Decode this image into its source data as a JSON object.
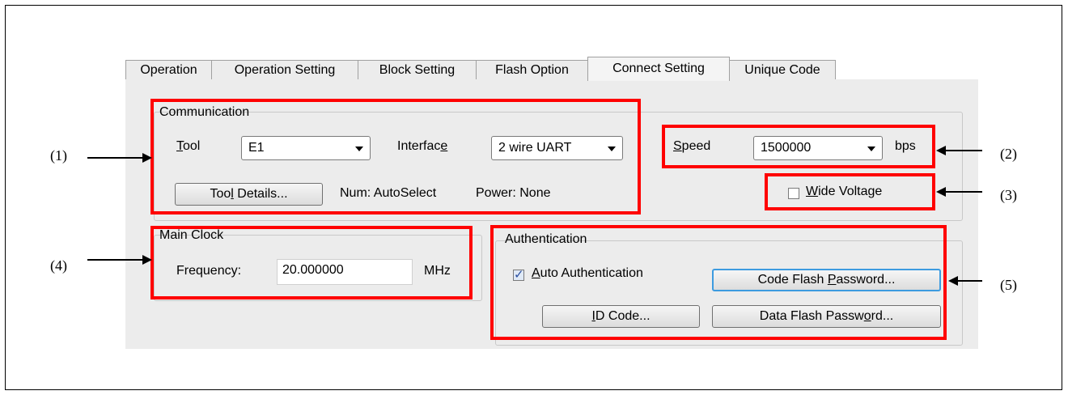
{
  "tabs": [
    {
      "label": "Operation"
    },
    {
      "label": "Operation Setting"
    },
    {
      "label": "Block Setting"
    },
    {
      "label": "Flash Option"
    },
    {
      "label": "Connect Setting"
    },
    {
      "label": "Unique Code"
    }
  ],
  "active_tab": "Connect Setting",
  "communication": {
    "title": "Communication",
    "tool_label": "Tool",
    "tool_value": "E1",
    "interface_label": "Interface",
    "interface_value": "2 wire UART",
    "tool_details_button": "Tool Details...",
    "num_text": "Num: AutoSelect",
    "power_text": "Power: None"
  },
  "speed": {
    "label": "Speed",
    "value": "1500000",
    "unit": "bps"
  },
  "wide_voltage": {
    "label": "Wide Voltage",
    "checked": false
  },
  "main_clock": {
    "title": "Main Clock",
    "frequency_label": "Frequency:",
    "frequency_value": "20.000000",
    "unit": "MHz"
  },
  "authentication": {
    "title": "Authentication",
    "auto_label": "Auto Authentication",
    "auto_checked": true,
    "code_flash_button": "Code Flash Password...",
    "id_code_button": "ID Code...",
    "data_flash_button": "Data Flash Password..."
  },
  "callouts": [
    "(1)",
    "(2)",
    "(3)",
    "(4)",
    "(5)"
  ],
  "colors": {
    "highlight": "#ff0000",
    "panel": "#ececec",
    "focus": "#3d9be0"
  }
}
